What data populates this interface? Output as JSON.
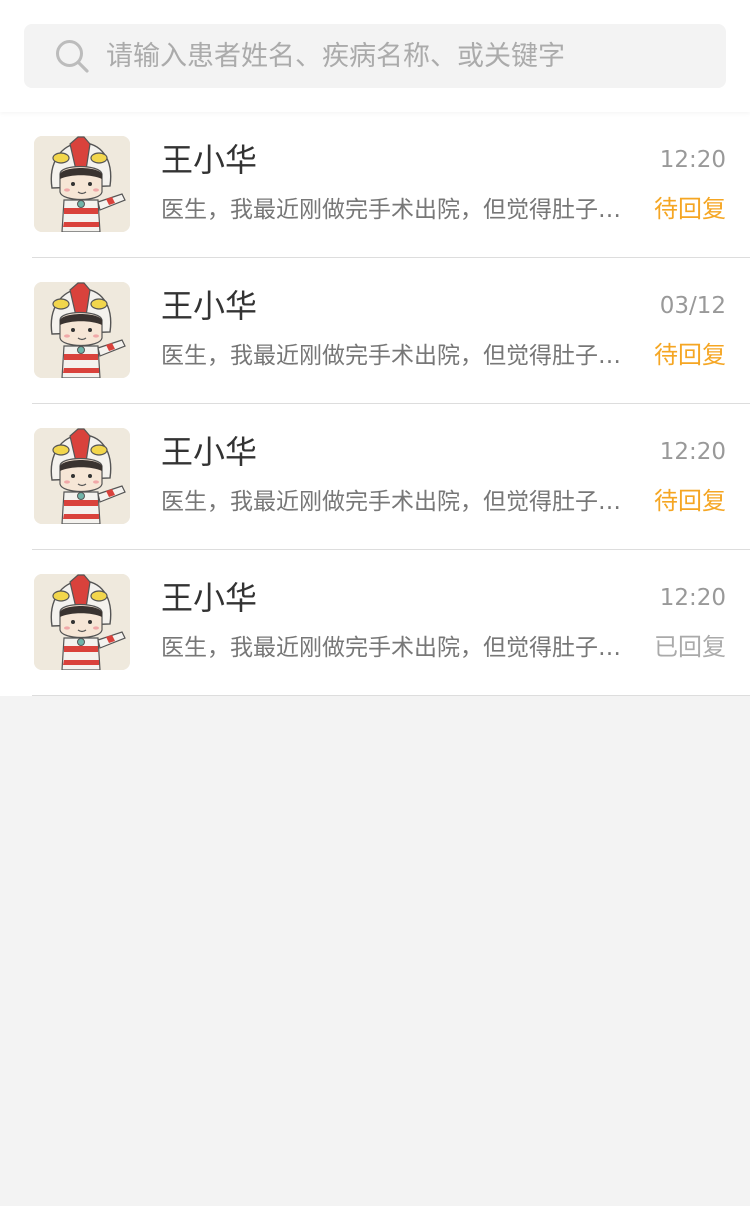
{
  "search": {
    "placeholder": "请输入患者姓名、疾病名称、或关键字",
    "value": ""
  },
  "colors": {
    "pending": "#f5a623",
    "replied": "#aaaaaa"
  },
  "patients": [
    {
      "name": "王小华",
      "time": "12:20",
      "message": "医生，我最近刚做完手术出院，但觉得肚子还是不舒服",
      "status": "待回复",
      "status_type": "pending"
    },
    {
      "name": "王小华",
      "time": "03/12",
      "message": "医生，我最近刚做完手术出院，但觉得肚子还是不舒服",
      "status": "待回复",
      "status_type": "pending"
    },
    {
      "name": "王小华",
      "time": "12:20",
      "message": "医生，我最近刚做完手术出院，但觉得肚子还是不舒服",
      "status": "待回复",
      "status_type": "pending"
    },
    {
      "name": "王小华",
      "time": "12:20",
      "message": "医生，我最近刚做完手术出院，但觉得肚子还是不舒服",
      "status": "已回复",
      "status_type": "replied"
    }
  ]
}
